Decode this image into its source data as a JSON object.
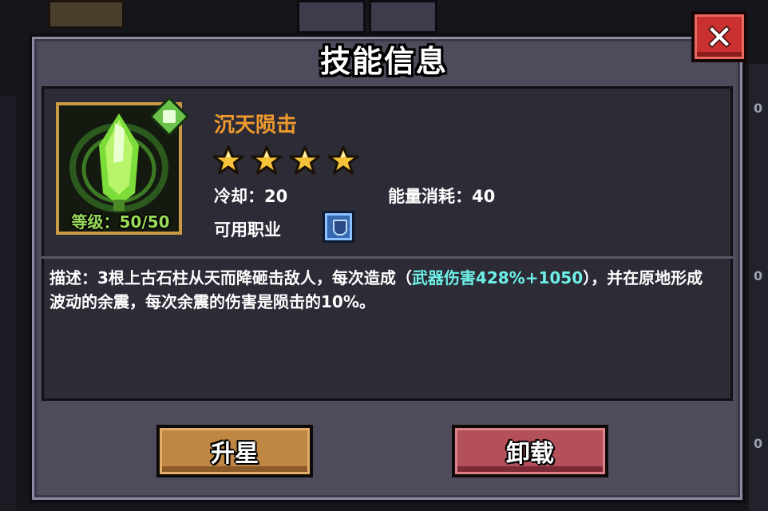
{
  "dialog": {
    "title": "技能信息",
    "close_icon": "close-x-icon"
  },
  "skill": {
    "name": "沉天陨击",
    "level_text": "等级：50/50",
    "stars": 4,
    "cooldown_text": "冷却：20",
    "energy_text": "能量消耗：40",
    "job_label": "可用职业",
    "job_icon": "class-shield-icon",
    "description_prefix": "描述：3根上古石柱从天而降砸击敌人，每次造成（",
    "description_highlight": "武器伤害428%+1050",
    "description_suffix": "），并在原地形成波动的余震，每次余震的伤害是陨击的10%。"
  },
  "buttons": {
    "upgrade_label": "升星",
    "unequip_label": "卸载"
  },
  "background": {
    "right_numbers": [
      "0",
      "0",
      "0"
    ]
  },
  "colors": {
    "skill_name": "#f09a2e",
    "level_text": "#9adc5a",
    "highlight": "#6ef0e8",
    "upgrade_button": "#c08644",
    "unequip_button": "#b4505a",
    "close_button": "#c93030"
  }
}
